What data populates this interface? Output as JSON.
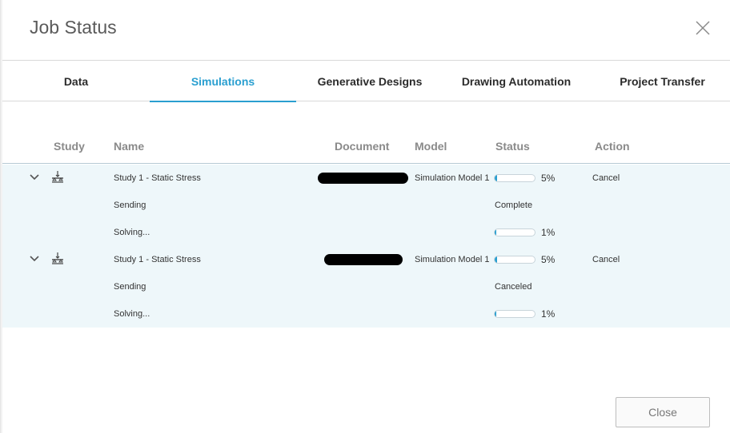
{
  "dialog": {
    "title": "Job Status",
    "close_button": "Close"
  },
  "tabs": [
    {
      "label": "Data",
      "active": false
    },
    {
      "label": "Simulations",
      "active": true
    },
    {
      "label": "Generative Designs",
      "active": false
    },
    {
      "label": "Drawing Automation",
      "active": false
    },
    {
      "label": "Project Transfer",
      "active": false
    }
  ],
  "table": {
    "headers": {
      "study": "Study",
      "name": "Name",
      "document": "Document",
      "model": "Model",
      "status": "Status",
      "action": "Action"
    },
    "jobs": [
      {
        "name": "Study 1 - Static Stress",
        "document": "[redacted]",
        "model": "Simulation Model 1",
        "progress": 0.05,
        "progress_text": "5%",
        "action": "Cancel",
        "steps": [
          {
            "name": "Sending",
            "status": "Complete"
          },
          {
            "name": "Solving...",
            "progress": 0.01,
            "progress_text": "1%"
          }
        ]
      },
      {
        "name": "Study 1 - Static Stress",
        "document": "[redacted]",
        "model": "Simulation Model 1",
        "progress": 0.05,
        "progress_text": "5%",
        "action": "Cancel",
        "steps": [
          {
            "name": "Sending",
            "status": "Canceled"
          },
          {
            "name": "Solving...",
            "progress": 0.01,
            "progress_text": "1%"
          }
        ]
      }
    ]
  },
  "colors": {
    "accent": "#2a9fd0",
    "row_background": "#eef7fa",
    "header_text": "#8a8a8a"
  },
  "icons": {
    "close": "close-icon",
    "expand": "chevron-down-icon",
    "study": "simulation-study-icon"
  }
}
